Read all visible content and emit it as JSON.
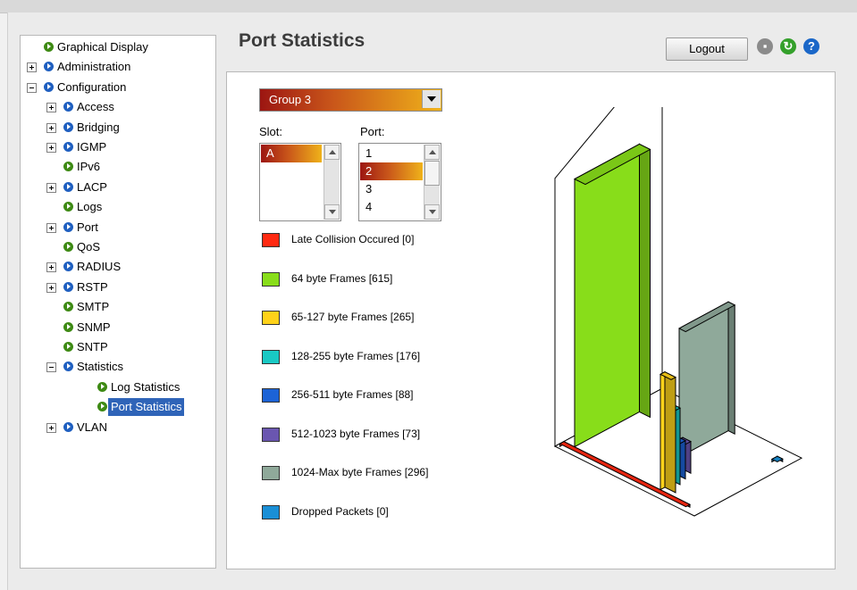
{
  "tree": {
    "items": [
      {
        "label": "Graphical Display",
        "level": 0,
        "expander": "none",
        "icon": "green",
        "name": "tree-item-graphical-display"
      },
      {
        "label": "Administration",
        "level": 0,
        "expander": "plus",
        "icon": "blue",
        "name": "tree-item-administration"
      },
      {
        "label": "Configuration",
        "level": 0,
        "expander": "minus",
        "icon": "blue",
        "name": "tree-item-configuration"
      },
      {
        "label": "Access",
        "level": 1,
        "expander": "plus",
        "icon": "blue",
        "name": "tree-item-access"
      },
      {
        "label": "Bridging",
        "level": 1,
        "expander": "plus",
        "icon": "blue",
        "name": "tree-item-bridging"
      },
      {
        "label": "IGMP",
        "level": 1,
        "expander": "plus",
        "icon": "blue",
        "name": "tree-item-igmp"
      },
      {
        "label": "IPv6",
        "level": 1,
        "expander": "none",
        "icon": "green",
        "name": "tree-item-ipv6"
      },
      {
        "label": "LACP",
        "level": 1,
        "expander": "plus",
        "icon": "blue",
        "name": "tree-item-lacp"
      },
      {
        "label": "Logs",
        "level": 1,
        "expander": "none",
        "icon": "green",
        "name": "tree-item-logs"
      },
      {
        "label": "Port",
        "level": 1,
        "expander": "plus",
        "icon": "blue",
        "name": "tree-item-port"
      },
      {
        "label": "QoS",
        "level": 1,
        "expander": "none",
        "icon": "green",
        "name": "tree-item-qos"
      },
      {
        "label": "RADIUS",
        "level": 1,
        "expander": "plus",
        "icon": "blue",
        "name": "tree-item-radius"
      },
      {
        "label": "RSTP",
        "level": 1,
        "expander": "plus",
        "icon": "blue",
        "name": "tree-item-rstp"
      },
      {
        "label": "SMTP",
        "level": 1,
        "expander": "none",
        "icon": "green",
        "name": "tree-item-smtp"
      },
      {
        "label": "SNMP",
        "level": 1,
        "expander": "none",
        "icon": "green",
        "name": "tree-item-snmp"
      },
      {
        "label": "SNTP",
        "level": 1,
        "expander": "none",
        "icon": "green",
        "name": "tree-item-sntp"
      },
      {
        "label": "Statistics",
        "level": 1,
        "expander": "minus",
        "icon": "blue",
        "name": "tree-item-statistics"
      },
      {
        "label": "Log Statistics",
        "level": 2,
        "expander": "none",
        "icon": "green",
        "name": "tree-item-log-statistics"
      },
      {
        "label": "Port Statistics",
        "level": 2,
        "expander": "none",
        "icon": "green",
        "selected": true,
        "name": "tree-item-port-statistics"
      },
      {
        "label": "VLAN",
        "level": 1,
        "expander": "plus",
        "icon": "blue",
        "name": "tree-item-vlan"
      }
    ]
  },
  "header": {
    "title": "Port Statistics",
    "logout_label": "Logout",
    "icons": [
      "save-icon",
      "refresh-icon",
      "help-icon"
    ]
  },
  "controls": {
    "group_value": "Group 3",
    "slot_label": "Slot:",
    "port_label": "Port:",
    "slot_options": [
      "A"
    ],
    "slot_selected": "A",
    "port_options": [
      "1",
      "2",
      "3",
      "4"
    ],
    "port_selected": "2"
  },
  "legend": [
    {
      "label": "Late Collision Occured [0]",
      "color": "#ff2a12"
    },
    {
      "label": "64 byte Frames [615]",
      "color": "#88dd1a"
    },
    {
      "label": "65-127 byte Frames [265]",
      "color": "#ffd21a"
    },
    {
      "label": "128-255 byte Frames [176]",
      "color": "#19c9c4"
    },
    {
      "label": "256-511 byte Frames [88]",
      "color": "#1c63d6"
    },
    {
      "label": "512-1023 byte Frames [73]",
      "color": "#6a56b0"
    },
    {
      "label": "1024-Max byte Frames [296]",
      "color": "#8fa99a"
    },
    {
      "label": "Dropped Packets [0]",
      "color": "#1a8fd6"
    }
  ],
  "chart_data": {
    "type": "bar",
    "categories": [
      "Late Collision Occured",
      "64 byte Frames",
      "65-127 byte Frames",
      "128-255 byte Frames",
      "256-511 byte Frames",
      "512-1023 byte Frames",
      "1024-Max byte Frames",
      "Dropped Packets"
    ],
    "values": [
      0,
      615,
      265,
      176,
      88,
      73,
      296,
      0
    ],
    "colors": [
      "#ff2a12",
      "#88dd1a",
      "#ffd21a",
      "#19c9c4",
      "#1c63d6",
      "#6a56b0",
      "#8fa99a",
      "#1a8fd6"
    ],
    "style": "3d",
    "title": "",
    "xlabel": "",
    "ylabel": ""
  }
}
